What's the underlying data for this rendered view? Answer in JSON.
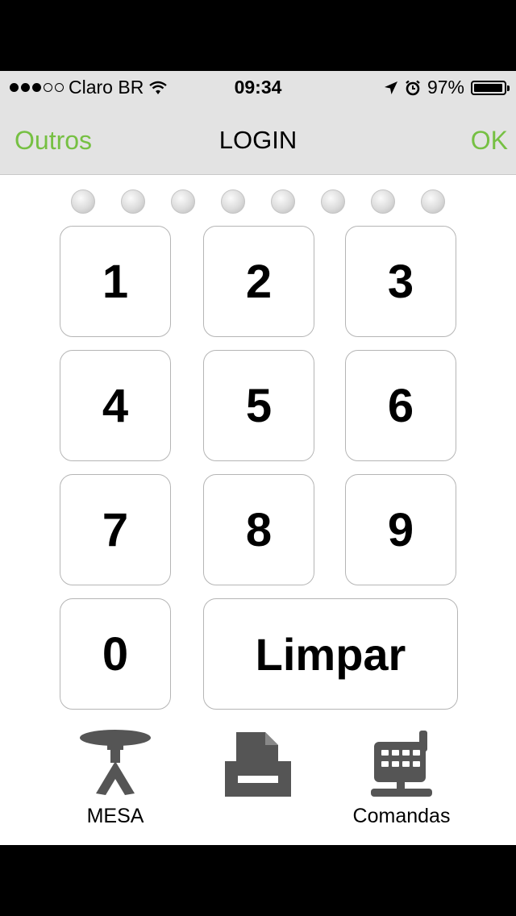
{
  "status": {
    "carrier": "Claro BR",
    "time": "09:34",
    "battery": "97%",
    "battery_level": 0.97,
    "signal_bars": 3,
    "icons": [
      "wifi-icon",
      "location-arrow-icon",
      "alarm-icon",
      "battery-icon"
    ]
  },
  "nav": {
    "left_label": "Outros",
    "title": "LOGIN",
    "right_label": "OK",
    "accent_color": "#76c043"
  },
  "pin": {
    "length": 8,
    "filled": 0
  },
  "keypad": {
    "keys": [
      "1",
      "2",
      "3",
      "4",
      "5",
      "6",
      "7",
      "8",
      "9",
      "0"
    ],
    "clear_label": "Limpar"
  },
  "bottom": {
    "mesa_label": "MESA",
    "printer_label": "",
    "comandas_label": "Comandas",
    "icons": [
      "table-icon",
      "printer-icon",
      "pos-terminal-icon"
    ]
  }
}
